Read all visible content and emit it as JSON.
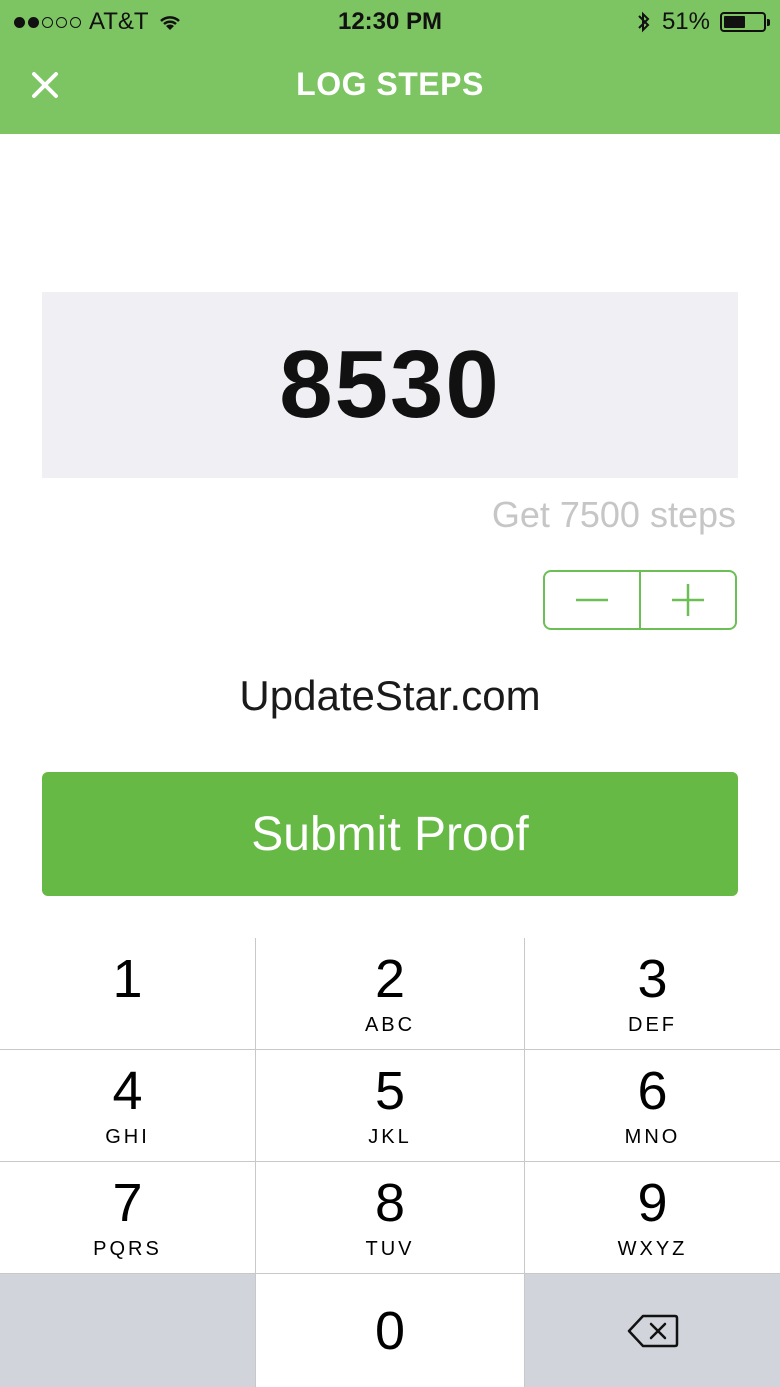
{
  "status_bar": {
    "carrier": "AT&T",
    "time": "12:30 PM",
    "battery": "51%",
    "battery_level": 0.51
  },
  "nav": {
    "title": "LOG STEPS",
    "close_icon": "close-icon"
  },
  "steps": {
    "value": "8530",
    "goal_text": "Get 7500 steps"
  },
  "stepper": {
    "minus_icon": "minus-icon",
    "plus_icon": "plus-icon"
  },
  "watermark": "UpdateStar.com",
  "submit": {
    "label": "Submit Proof"
  },
  "keypad": {
    "keys": [
      {
        "num": "1",
        "letters": ""
      },
      {
        "num": "2",
        "letters": "ABC"
      },
      {
        "num": "3",
        "letters": "DEF"
      },
      {
        "num": "4",
        "letters": "GHI"
      },
      {
        "num": "5",
        "letters": "JKL"
      },
      {
        "num": "6",
        "letters": "MNO"
      },
      {
        "num": "7",
        "letters": "PQRS"
      },
      {
        "num": "8",
        "letters": "TUV"
      },
      {
        "num": "9",
        "letters": "WXYZ"
      },
      {
        "num": "0",
        "letters": ""
      }
    ],
    "delete_icon": "backspace-icon"
  },
  "colors": {
    "header_green": "#7dc462",
    "button_green": "#67b946",
    "stepper_green": "#6cbf55",
    "input_bg": "#f0eff4",
    "hint_gray": "#c6c6c6"
  }
}
